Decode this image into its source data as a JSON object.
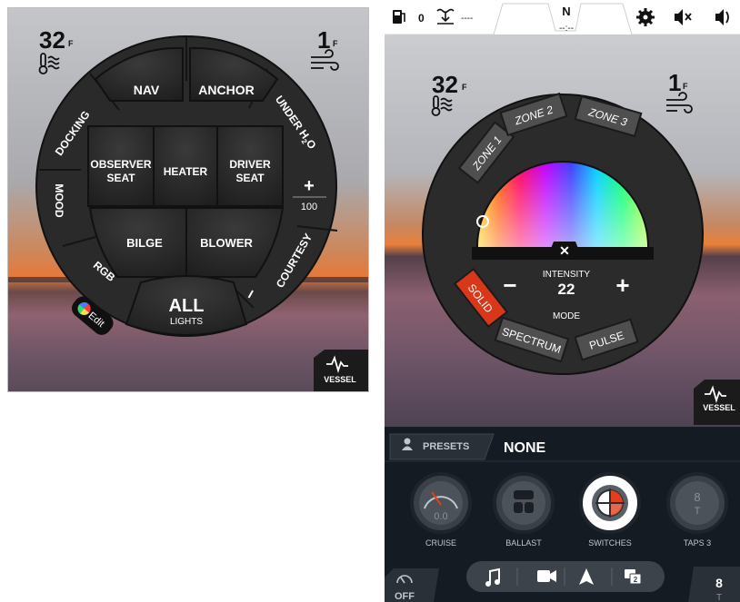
{
  "left": {
    "water_temp": "32",
    "water_unit": "F",
    "air_temp": "1",
    "air_unit": "F",
    "nav_label": "NAV",
    "anchor_label": "ANCHOR",
    "docking_label": "DOCKING",
    "under_label": "UNDER H",
    "under_sub": "2",
    "under_tail": "O",
    "mood_label": "MOOD",
    "rgb_label": "RGB",
    "courtesy_label": "COURTESY",
    "observer_l1": "OBSERVER",
    "observer_l2": "SEAT",
    "heater_label": "HEATER",
    "driver_l1": "DRIVER",
    "driver_l2": "SEAT",
    "bilge_label": "BILGE",
    "blower_label": "BLOWER",
    "all_label": "ALL",
    "all_sub": "LIGHTS",
    "plus_label": "+",
    "dim_value": "100",
    "minus_label": "−",
    "edit_label": "Edit",
    "vessel_label": "VESSEL"
  },
  "right": {
    "status": {
      "fuel_value": "0",
      "depth_value": "----",
      "heading": "N",
      "time": "--:--"
    },
    "water_temp": "32",
    "water_unit": "F",
    "air_temp": "1",
    "air_unit": "F",
    "zones": [
      "ZONE 1",
      "ZONE 2",
      "ZONE 3"
    ],
    "intensity_label": "INTENSITY",
    "intensity_value": "22",
    "mode_label": "MODE",
    "modes": [
      "SOLID",
      "SPECTRUM",
      "PULSE"
    ],
    "close_label": "✕",
    "minus_label": "−",
    "plus_label": "+",
    "vessel_label": "VESSEL",
    "presets_label": "PRESETS",
    "preset_value": "NONE",
    "gauges": [
      {
        "label": "CRUISE",
        "value": "0.0"
      },
      {
        "label": "BALLAST",
        "value": ""
      },
      {
        "label": "SWITCHES",
        "value": ""
      },
      {
        "label": "TAPS 3",
        "value": "8",
        "sub": "T"
      }
    ],
    "cruise_off": "OFF",
    "taps_value": "8",
    "taps_sub": "T",
    "media_badge": "2"
  },
  "colors": {
    "button_dark": "#272727",
    "ring_dark": "#2f2f2f",
    "accent_red": "#e2401c",
    "bar_dark": "#151b22"
  }
}
